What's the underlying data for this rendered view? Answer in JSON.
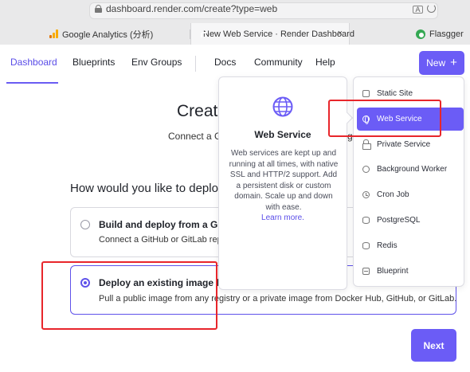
{
  "browser": {
    "url": "dashboard.render.com/create?type=web",
    "tabs": [
      {
        "label": "Google Analytics (分析)"
      },
      {
        "label": "New Web Service · Render Dashboard"
      },
      {
        "label": "Flasgger"
      }
    ],
    "tab_close": "×"
  },
  "nav": {
    "items": [
      "Dashboard",
      "Blueprints",
      "Env Groups",
      "Docs",
      "Community",
      "Help"
    ],
    "active": "Dashboard",
    "new_label": "New",
    "new_icon": "+"
  },
  "page": {
    "title": "Create",
    "subtitle": "Connect a Git",
    "subtitle_tail": "g",
    "question": "How would you like to deploy y",
    "options": [
      {
        "title": "Build and deploy from a Git repo",
        "desc": "Connect a GitHub or GitLab repo",
        "selected": false
      },
      {
        "title": "Deploy an existing image from",
        "desc": "Pull a public image from any registry or a private image from Docker Hub, GitHub, or GitLab.",
        "selected": true
      }
    ],
    "next_label": "Next"
  },
  "dropdown": {
    "info": {
      "icon": "globe-icon",
      "title": "Web Service",
      "description": "Web services are kept up and running at all times, with native SSL and HTTP/2 support. Add a persistent disk or custom domain. Scale up and down with ease.",
      "learn_more": "Learn more."
    },
    "items": [
      {
        "label": "Static Site",
        "icon": "static-site-icon"
      },
      {
        "label": "Web Service",
        "icon": "globe-icon",
        "active": true
      },
      {
        "label": "Private Service",
        "icon": "lock-icon"
      },
      {
        "label": "Background Worker",
        "icon": "worker-icon"
      },
      {
        "label": "Cron Job",
        "icon": "clock-icon"
      },
      {
        "label": "PostgreSQL",
        "icon": "database-icon"
      },
      {
        "label": "Redis",
        "icon": "database-icon"
      },
      {
        "label": "Blueprint",
        "icon": "blueprint-icon"
      }
    ]
  },
  "colors": {
    "accent": "#6b5cf6",
    "highlight": "#e8262b"
  }
}
